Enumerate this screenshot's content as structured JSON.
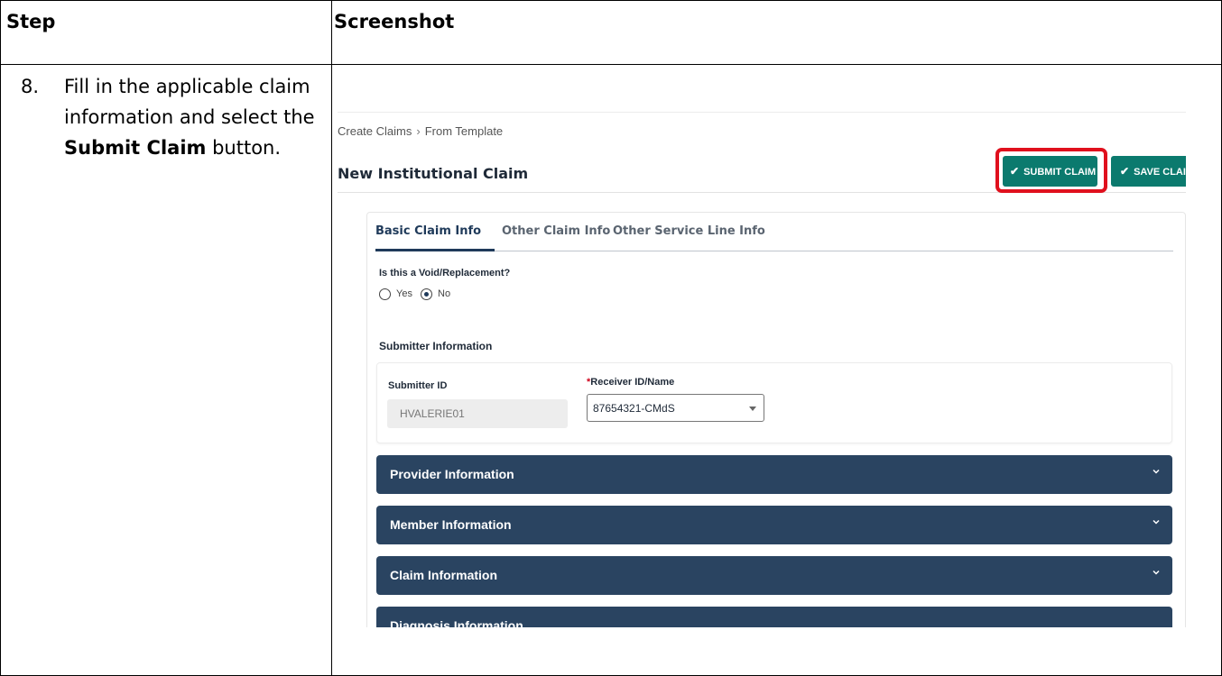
{
  "table": {
    "col_step": "Step",
    "col_screenshot": "Screenshot",
    "step_number": "8.",
    "instruction": {
      "before": "Fill in the applicable claim information and select the ",
      "bold1": "Submit Claim",
      "after": " button."
    }
  },
  "screen": {
    "breadcrumb": {
      "part1": "Create Claims",
      "separator": "›",
      "part2": "From Template"
    },
    "title": "New Institutional Claim",
    "buttons": {
      "submit": "SUBMIT CLAIM",
      "save": "SAVE CLAIM"
    },
    "highlight_color": "#e0101d",
    "accent_color": "#0b7a6e",
    "tabs": [
      "Basic Claim Info",
      "Other Claim Info",
      "Other Service Line Info"
    ],
    "void_question": "Is this a Void/Replacement?",
    "radio": {
      "yes": "Yes",
      "no": "No",
      "selected": "No"
    },
    "submitter_section": "Submitter Information",
    "submitter_id_label": "Submitter ID",
    "submitter_id_value": "HVALERIE01",
    "receiver_required": "*",
    "receiver_label": "Receiver ID/Name",
    "receiver_value": "87654321-CMdS",
    "accordions": [
      "Provider Information",
      "Member Information",
      "Claim Information",
      "Diagnosis Information"
    ],
    "accordion_color": "#2a4461"
  }
}
